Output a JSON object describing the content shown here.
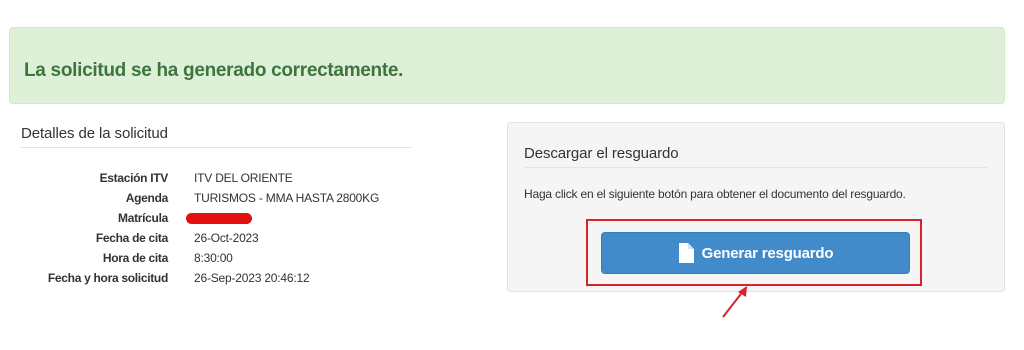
{
  "alert": {
    "message": "La solicitud se ha generado correctamente."
  },
  "details": {
    "title": "Detalles de la solicitud",
    "rows": [
      {
        "label": "Estación ITV",
        "value": "ITV DEL ORIENTE"
      },
      {
        "label": "Agenda",
        "value": "TURISMOS - MMA HASTA 2800KG"
      },
      {
        "label": "Matrícula",
        "value": ""
      },
      {
        "label": "Fecha de cita",
        "value": "26-Oct-2023"
      },
      {
        "label": "Hora de cita",
        "value": "8:30:00"
      },
      {
        "label": "Fecha y hora solicitud",
        "value": "26-Sep-2023 20:46:12"
      }
    ]
  },
  "download": {
    "title": "Descargar el resguardo",
    "hint": "Haga click en el siguiente botón para obtener el documento del resguardo.",
    "button_label": "Generar resguardo",
    "button_icon": "file-icon"
  },
  "colors": {
    "alert_bg": "#dff0d8",
    "alert_text": "#3c763d",
    "primary": "#428bca",
    "annotation_red": "#d9232a"
  }
}
